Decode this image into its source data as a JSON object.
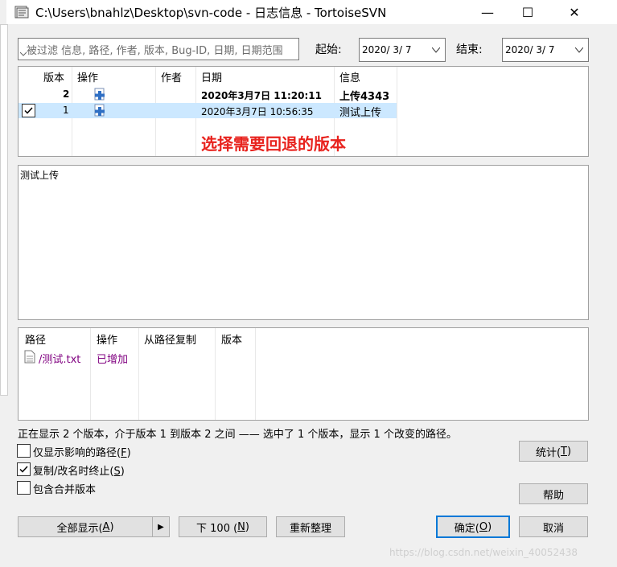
{
  "window": {
    "title": "C:\\Users\\bnahlz\\Desktop\\svn-code - 日志信息 - TortoiseSVN",
    "minimize": "—",
    "maximize": "☐",
    "close": "✕"
  },
  "filter": {
    "placeholder": "被过滤 信息, 路径, 作者, 版本, Bug-ID, 日期, 日期范围"
  },
  "dates": {
    "start_label": "起始:",
    "start_value": "2020/ 3/ 7",
    "end_label": "结束:",
    "end_value": "2020/ 3/ 7"
  },
  "revisions": {
    "headers": [
      "版本",
      "操作",
      "作者",
      "日期",
      "信息"
    ],
    "rows": [
      {
        "rev": "2",
        "author": "",
        "date": "2020年3月7日 11:20:11",
        "message": "上传4343",
        "checked": false,
        "bold": true
      },
      {
        "rev": "1",
        "author": "",
        "date": "2020年3月7日 10:56:35",
        "message": "测试上传",
        "checked": true,
        "bold": false
      }
    ],
    "annotation": "选择需要回退的版本"
  },
  "message_text": "测试上传",
  "paths": {
    "headers": [
      "路径",
      "操作",
      "从路径复制",
      "版本"
    ],
    "rows": [
      {
        "path": "/测试.txt",
        "action": "已增加",
        "copy_from": "",
        "revision": ""
      }
    ]
  },
  "status_text": "正在显示 2 个版本，介于版本 1 到版本 2 之间 —— 选中了 1 个版本，显示 1 个改变的路径。",
  "options": {
    "only_affected": {
      "label": "仅显示影响的路径(",
      "key": "F",
      "suffix": ")",
      "checked": false
    },
    "stop_on_copy": {
      "label": "复制/改名时终止(",
      "key": "S",
      "suffix": ")",
      "checked": true
    },
    "include_merged": {
      "label": "包含合并版本",
      "checked": false
    }
  },
  "buttons": {
    "stats": {
      "label": "统计(",
      "key": "T",
      "suffix": ")"
    },
    "help": {
      "label": "帮助"
    },
    "show_all": {
      "label": "全部显示(",
      "key": "A",
      "suffix": ")"
    },
    "show_all_arrow": "▶",
    "next100": {
      "label": "下 100 (",
      "key": "N",
      "suffix": ")"
    },
    "refresh": {
      "label": "重新整理"
    },
    "ok": {
      "label": "确定(",
      "key": "O",
      "suffix": ")"
    },
    "cancel": {
      "label": "取消"
    }
  },
  "watermark": "https://blog.csdn.net/weixin_40052438",
  "colors": {
    "annotation": "#e8221d",
    "added_action": "#800080",
    "selected_row": "#cce8ff",
    "default_button": "#0078d7"
  }
}
